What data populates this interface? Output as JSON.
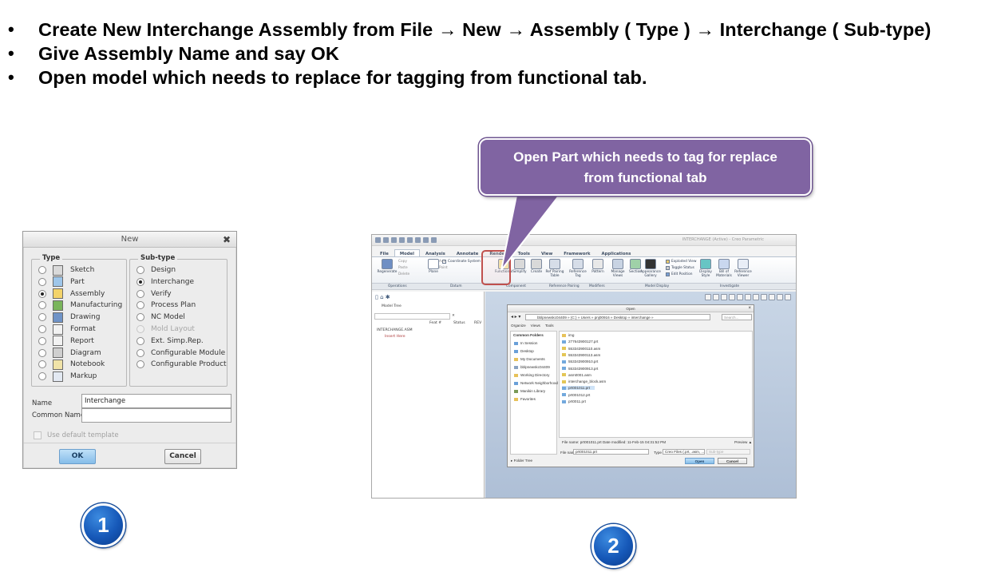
{
  "bullets": [
    "Create New Interchange Assembly from File → New → Assembly ( Type ) → Interchange ( Sub-type)",
    "Give Assembly Name and say OK",
    "Open model which needs to replace for tagging from functional tab."
  ],
  "bullet_symbol": "•",
  "new_dialog": {
    "title": "New",
    "close": "✖",
    "type_label": "Type",
    "subtype_label": "Sub-type",
    "types": [
      "Sketch",
      "Part",
      "Assembly",
      "Manufacturing",
      "Drawing",
      "Format",
      "Report",
      "Diagram",
      "Notebook",
      "Markup"
    ],
    "selected_type": "Assembly",
    "subtypes": [
      "Design",
      "Interchange",
      "Verify",
      "Process Plan",
      "NC Model",
      "Mold Layout",
      "Ext. Simp.Rep.",
      "Configurable Module",
      "Configurable Product"
    ],
    "selected_subtype": "Interchange",
    "disabled_subtype": "Mold Layout",
    "name_label": "Name",
    "name_value": "Interchange",
    "common_name_label": "Common Name",
    "common_name_value": "",
    "default_template_label": "Use default template",
    "ok_label": "OK",
    "cancel_label": "Cancel"
  },
  "steps": [
    "1",
    "2"
  ],
  "callout": {
    "line1": "Open Part which needs to tag for replace",
    "line2": "from functional tab",
    "color": "#8064a2"
  },
  "creo": {
    "window_title": "INTERCHANGE (Active) - Creo Parametric",
    "tabs": [
      "File",
      "Model",
      "Analysis",
      "Annotate",
      "Render",
      "Tools",
      "View",
      "Framework",
      "Applications"
    ],
    "active_tab": "Model",
    "ribbon": [
      "Regenerate",
      "Plane",
      "Coordinate System",
      "Functional",
      "Simplify",
      "Create",
      "Ref Pairing Table",
      "Reference Tag",
      "Pattern",
      "Manage Views",
      "Section",
      "Appearance Gallery",
      "Exploded View",
      "Toggle Status",
      "Edit Position",
      "Display Style",
      "Bill of Materials",
      "Reference Viewer"
    ],
    "ribbon_small": [
      "Copy",
      "Paste",
      "Delete",
      "Axis",
      "Point"
    ],
    "groups": [
      "Operations",
      "Datum",
      "Component",
      "Reference Pairing",
      "Modifiers",
      "Model Display",
      "Investigate"
    ],
    "model_tree": {
      "title": "Model Tree",
      "columns": [
        "Feat #",
        "Status",
        "REV"
      ],
      "root": "INTERCHANGE.ASM",
      "insert": "Insert Here"
    }
  },
  "open_dialog": {
    "title": "Open",
    "address": "bblpnewskc04409 » (C:) » Users » pnj00916 » Desktop » interchange »",
    "search_placeholder": "Search...",
    "toolbar": [
      "Organize",
      "Views",
      "Tools"
    ],
    "common_folders_title": "Common Folders",
    "common_folders": [
      "In Session",
      "Desktop",
      "My Documents",
      "bblpnewskc04409",
      "Working Directory",
      "Network Neighborhood",
      "Manikin Library",
      "Favorites"
    ],
    "folder_tree": "Folder Tree",
    "files": [
      "img",
      "277643900127.prt",
      "553343900110.asm",
      "553343900113.asm",
      "553343900910.prt",
      "553343900913.prt",
      "asm0001.asm",
      "interchange_block.asm",
      "prt001011.prt",
      "prt001012.prt",
      "prt0011.prt"
    ],
    "selected_file": "prt001011.prt",
    "info_text": "File name: prt001011.prt  Date modified: 11-Feb-15 04:31:52 PM",
    "preview": "Preview ▲",
    "file_name_label": "File name",
    "file_name_value": "prt001011.prt",
    "type_label": "Type",
    "type_value": "Creo Files (.prt, .asm, ...)",
    "subtype_placeholder": "Sub-type",
    "open_label": "Open",
    "cancel_label": "Cancel"
  }
}
